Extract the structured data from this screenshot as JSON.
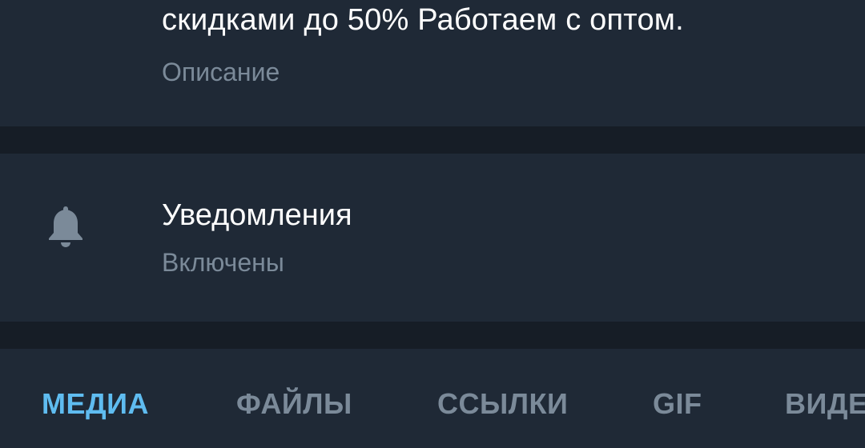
{
  "description": {
    "text": "скидками до 50% Работаем с оптом.",
    "label": "Описание"
  },
  "notifications": {
    "icon": "bell-icon",
    "title": "Уведомления",
    "status": "Включены"
  },
  "tabs": [
    {
      "label": "МЕДИА",
      "active": true
    },
    {
      "label": "ФАЙЛЫ",
      "active": false
    },
    {
      "label": "ССЫЛКИ",
      "active": false
    },
    {
      "label": "GIF",
      "active": false
    },
    {
      "label": "ВИДЕ",
      "active": false
    }
  ],
  "colors": {
    "background": "#1f2936",
    "separator": "#161d26",
    "primary_text": "#ffffff",
    "secondary_text": "#7b8a99",
    "accent": "#5fbcf0"
  }
}
